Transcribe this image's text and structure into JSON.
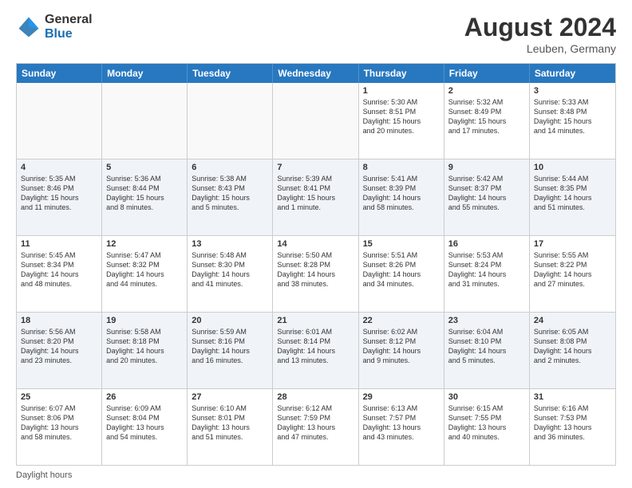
{
  "header": {
    "logo_general": "General",
    "logo_blue": "Blue",
    "month_year": "August 2024",
    "location": "Leuben, Germany"
  },
  "days_of_week": [
    "Sunday",
    "Monday",
    "Tuesday",
    "Wednesday",
    "Thursday",
    "Friday",
    "Saturday"
  ],
  "footer": {
    "note": "Daylight hours"
  },
  "weeks": [
    [
      {
        "day": "",
        "info": ""
      },
      {
        "day": "",
        "info": ""
      },
      {
        "day": "",
        "info": ""
      },
      {
        "day": "",
        "info": ""
      },
      {
        "day": "1",
        "info": "Sunrise: 5:30 AM\nSunset: 8:51 PM\nDaylight: 15 hours\nand 20 minutes."
      },
      {
        "day": "2",
        "info": "Sunrise: 5:32 AM\nSunset: 8:49 PM\nDaylight: 15 hours\nand 17 minutes."
      },
      {
        "day": "3",
        "info": "Sunrise: 5:33 AM\nSunset: 8:48 PM\nDaylight: 15 hours\nand 14 minutes."
      }
    ],
    [
      {
        "day": "4",
        "info": "Sunrise: 5:35 AM\nSunset: 8:46 PM\nDaylight: 15 hours\nand 11 minutes."
      },
      {
        "day": "5",
        "info": "Sunrise: 5:36 AM\nSunset: 8:44 PM\nDaylight: 15 hours\nand 8 minutes."
      },
      {
        "day": "6",
        "info": "Sunrise: 5:38 AM\nSunset: 8:43 PM\nDaylight: 15 hours\nand 5 minutes."
      },
      {
        "day": "7",
        "info": "Sunrise: 5:39 AM\nSunset: 8:41 PM\nDaylight: 15 hours\nand 1 minute."
      },
      {
        "day": "8",
        "info": "Sunrise: 5:41 AM\nSunset: 8:39 PM\nDaylight: 14 hours\nand 58 minutes."
      },
      {
        "day": "9",
        "info": "Sunrise: 5:42 AM\nSunset: 8:37 PM\nDaylight: 14 hours\nand 55 minutes."
      },
      {
        "day": "10",
        "info": "Sunrise: 5:44 AM\nSunset: 8:35 PM\nDaylight: 14 hours\nand 51 minutes."
      }
    ],
    [
      {
        "day": "11",
        "info": "Sunrise: 5:45 AM\nSunset: 8:34 PM\nDaylight: 14 hours\nand 48 minutes."
      },
      {
        "day": "12",
        "info": "Sunrise: 5:47 AM\nSunset: 8:32 PM\nDaylight: 14 hours\nand 44 minutes."
      },
      {
        "day": "13",
        "info": "Sunrise: 5:48 AM\nSunset: 8:30 PM\nDaylight: 14 hours\nand 41 minutes."
      },
      {
        "day": "14",
        "info": "Sunrise: 5:50 AM\nSunset: 8:28 PM\nDaylight: 14 hours\nand 38 minutes."
      },
      {
        "day": "15",
        "info": "Sunrise: 5:51 AM\nSunset: 8:26 PM\nDaylight: 14 hours\nand 34 minutes."
      },
      {
        "day": "16",
        "info": "Sunrise: 5:53 AM\nSunset: 8:24 PM\nDaylight: 14 hours\nand 31 minutes."
      },
      {
        "day": "17",
        "info": "Sunrise: 5:55 AM\nSunset: 8:22 PM\nDaylight: 14 hours\nand 27 minutes."
      }
    ],
    [
      {
        "day": "18",
        "info": "Sunrise: 5:56 AM\nSunset: 8:20 PM\nDaylight: 14 hours\nand 23 minutes."
      },
      {
        "day": "19",
        "info": "Sunrise: 5:58 AM\nSunset: 8:18 PM\nDaylight: 14 hours\nand 20 minutes."
      },
      {
        "day": "20",
        "info": "Sunrise: 5:59 AM\nSunset: 8:16 PM\nDaylight: 14 hours\nand 16 minutes."
      },
      {
        "day": "21",
        "info": "Sunrise: 6:01 AM\nSunset: 8:14 PM\nDaylight: 14 hours\nand 13 minutes."
      },
      {
        "day": "22",
        "info": "Sunrise: 6:02 AM\nSunset: 8:12 PM\nDaylight: 14 hours\nand 9 minutes."
      },
      {
        "day": "23",
        "info": "Sunrise: 6:04 AM\nSunset: 8:10 PM\nDaylight: 14 hours\nand 5 minutes."
      },
      {
        "day": "24",
        "info": "Sunrise: 6:05 AM\nSunset: 8:08 PM\nDaylight: 14 hours\nand 2 minutes."
      }
    ],
    [
      {
        "day": "25",
        "info": "Sunrise: 6:07 AM\nSunset: 8:06 PM\nDaylight: 13 hours\nand 58 minutes."
      },
      {
        "day": "26",
        "info": "Sunrise: 6:09 AM\nSunset: 8:04 PM\nDaylight: 13 hours\nand 54 minutes."
      },
      {
        "day": "27",
        "info": "Sunrise: 6:10 AM\nSunset: 8:01 PM\nDaylight: 13 hours\nand 51 minutes."
      },
      {
        "day": "28",
        "info": "Sunrise: 6:12 AM\nSunset: 7:59 PM\nDaylight: 13 hours\nand 47 minutes."
      },
      {
        "day": "29",
        "info": "Sunrise: 6:13 AM\nSunset: 7:57 PM\nDaylight: 13 hours\nand 43 minutes."
      },
      {
        "day": "30",
        "info": "Sunrise: 6:15 AM\nSunset: 7:55 PM\nDaylight: 13 hours\nand 40 minutes."
      },
      {
        "day": "31",
        "info": "Sunrise: 6:16 AM\nSunset: 7:53 PM\nDaylight: 13 hours\nand 36 minutes."
      }
    ]
  ]
}
